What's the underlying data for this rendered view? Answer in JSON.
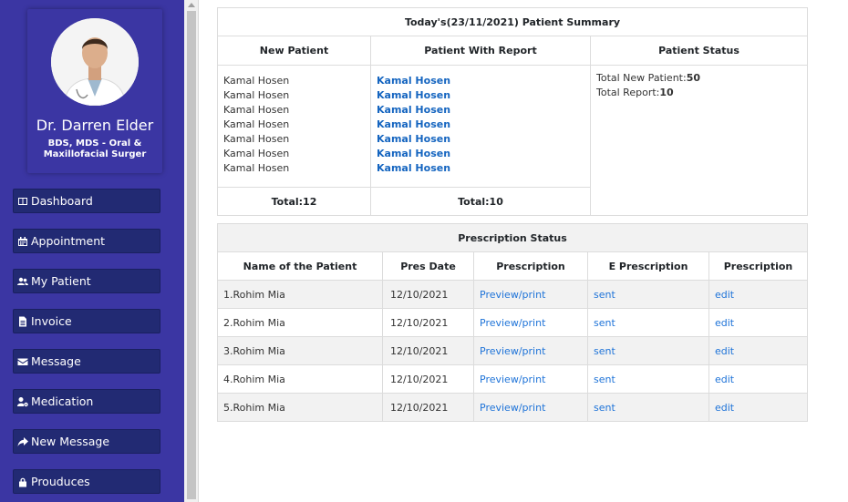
{
  "sidebar": {
    "doctor_name": "Dr. Darren Elder",
    "doctor_degree": "BDS, MDS - Oral & Maxillofacial Surger",
    "items": [
      {
        "label": "Dashboard",
        "icon": "columns-icon"
      },
      {
        "label": "Appointment",
        "icon": "calendar-icon"
      },
      {
        "label": "My Patient",
        "icon": "users-icon"
      },
      {
        "label": "Invoice",
        "icon": "file-icon"
      },
      {
        "label": "Message",
        "icon": "envelope-icon"
      },
      {
        "label": "Medication",
        "icon": "user-cog-icon"
      },
      {
        "label": "New Message",
        "icon": "share-icon"
      },
      {
        "label": "Prouduces",
        "icon": "lock-icon"
      }
    ]
  },
  "summary": {
    "title": "Today's(23/11/2021) Patient Summary",
    "headers": [
      "New Patient",
      "Patient With Report",
      "Patient Status"
    ],
    "new_patients": [
      "Kamal Hosen",
      "Kamal Hosen",
      "Kamal Hosen",
      "Kamal Hosen",
      "Kamal Hosen",
      "Kamal Hosen",
      "Kamal Hosen"
    ],
    "report_patients": [
      "Kamal Hosen",
      "Kamal Hosen",
      "Kamal Hosen",
      "Kamal Hosen",
      "Kamal Hosen",
      "Kamal Hosen",
      "Kamal Hosen"
    ],
    "status": {
      "new_label": "Total New Patient:",
      "new_value": "50",
      "report_label": "Total Report:",
      "report_value": "10"
    },
    "total_new": "Total:12",
    "total_report": "Total:10"
  },
  "prescription": {
    "title": "Prescription Status",
    "headers": [
      "Name of the Patient",
      "Pres Date",
      "Prescription",
      "E Prescription",
      "Prescription"
    ],
    "rows": [
      {
        "name": "1.Rohim Mia",
        "date": "12/10/2021",
        "preview": "Preview",
        "print": "print",
        "eprescription": "sent",
        "action": "edit"
      },
      {
        "name": "2.Rohim Mia",
        "date": "12/10/2021",
        "preview": "Preview",
        "print": "print",
        "eprescription": "sent",
        "action": "edit"
      },
      {
        "name": "3.Rohim Mia",
        "date": "12/10/2021",
        "preview": "Preview",
        "print": "print",
        "eprescription": "sent",
        "action": "edit"
      },
      {
        "name": "4.Rohim Mia",
        "date": "12/10/2021",
        "preview": "Preview",
        "print": "print",
        "eprescription": "sent",
        "action": "edit"
      },
      {
        "name": "5.Rohim Mia",
        "date": "12/10/2021",
        "preview": "Preview",
        "print": "print",
        "eprescription": "sent",
        "action": "edit"
      }
    ]
  },
  "colors": {
    "sidebar_bg": "#3b36a3",
    "nav_bg": "#222a73",
    "link": "#1565c0"
  }
}
